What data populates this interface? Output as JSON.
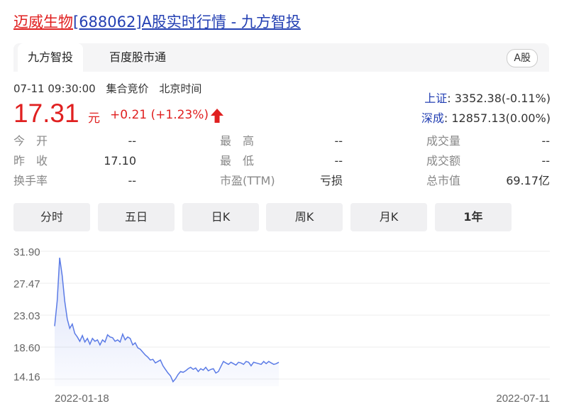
{
  "title": {
    "name_link": "迈威生物",
    "rest_link": "[688062]A股实时行情 - 九方智投"
  },
  "tabs": {
    "active": "九方智投",
    "second": "百度股市通",
    "market_badge": "A股"
  },
  "meta": {
    "time": "07-11 09:30:00",
    "session": "集合竞价",
    "tz": "北京时间"
  },
  "quote": {
    "price": "17.31",
    "unit": "元",
    "change": "+0.21 (+1.23%)"
  },
  "indices": [
    {
      "name": "上证",
      "value": ": 3352.38(-0.11%)"
    },
    {
      "name": "深成",
      "value": ": 12857.13(0.00%)"
    }
  ],
  "stats": [
    [
      {
        "label": "今　开",
        "value": "--"
      },
      {
        "label": "最　高",
        "value": "--"
      },
      {
        "label": "成交量",
        "value": "--"
      }
    ],
    [
      {
        "label": "昨　收",
        "value": "17.10"
      },
      {
        "label": "最　低",
        "value": "--"
      },
      {
        "label": "成交额",
        "value": "--"
      }
    ],
    [
      {
        "label": "换手率",
        "value": "--"
      },
      {
        "label": "市盈(TTM)",
        "value": "亏损"
      },
      {
        "label": "总市值",
        "value": "69.17亿"
      }
    ]
  ],
  "periods": [
    "分时",
    "五日",
    "日K",
    "周K",
    "月K",
    "1年"
  ],
  "active_period": "1年",
  "colors": {
    "up": "#e02020",
    "link": "#2440b3",
    "line": "#5b7be6"
  },
  "chart_data": {
    "type": "area",
    "y_ticks": [
      "31.90",
      "27.47",
      "23.03",
      "18.60",
      "14.16"
    ],
    "ylim": [
      14.16,
      31.9
    ],
    "x_labels": [
      "2022-01-18",
      "2022-07-11"
    ],
    "values": [
      21.5,
      25.0,
      31.0,
      28.5,
      25.0,
      22.5,
      21.2,
      21.8,
      20.5,
      20.0,
      19.4,
      20.2,
      19.3,
      19.8,
      19.0,
      19.8,
      19.4,
      19.6,
      18.9,
      19.6,
      19.3,
      20.3,
      20.0,
      19.9,
      19.4,
      19.6,
      19.3,
      20.4,
      19.6,
      20.0,
      19.8,
      18.9,
      19.2,
      18.5,
      18.3,
      17.9,
      17.5,
      17.2,
      16.8,
      16.9,
      16.4,
      16.6,
      16.8,
      16.0,
      15.5,
      15.0,
      14.6,
      13.8,
      14.2,
      14.8,
      15.2,
      15.1,
      15.3,
      15.6,
      15.8,
      15.5,
      15.7,
      15.2,
      15.6,
      15.4,
      15.8,
      15.3,
      15.5,
      15.6,
      15.0,
      15.2,
      15.9,
      16.6,
      16.4,
      16.2,
      16.5,
      16.3,
      16.1,
      16.5,
      16.4,
      16.2,
      16.6,
      16.5,
      16.0,
      16.5,
      16.4,
      16.3,
      16.2,
      16.6,
      16.3,
      16.6,
      16.4,
      16.2,
      16.3,
      16.5
    ]
  }
}
